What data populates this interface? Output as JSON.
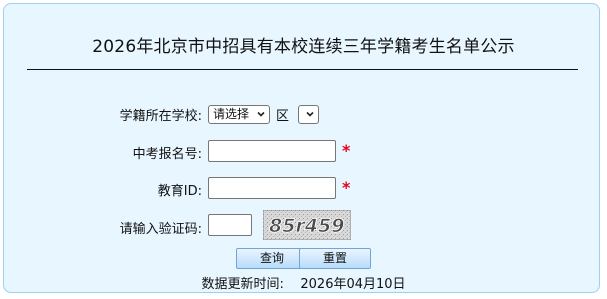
{
  "page": {
    "title": "2026年北京市中招具有本校连续三年学籍考生名单公示"
  },
  "form": {
    "school_label": "学籍所在学校:",
    "school_select_value": "请选择",
    "district_label": "区",
    "district_select_value": "",
    "exam_id_label": "中考报名号:",
    "exam_id_value": "",
    "edu_id_label": "教育ID:",
    "edu_id_value": "",
    "required_mark": "*",
    "captcha_label": "请输入验证码:",
    "captcha_value": "",
    "captcha_text": "85r459"
  },
  "buttons": {
    "query": "查询",
    "reset": "重置"
  },
  "footer": {
    "update_label": "数据更新时间:",
    "update_date": "2026年04月10日"
  },
  "colors": {
    "panel_bg": "#e8f6ff",
    "panel_border": "#9dd0ee",
    "required": "#e8001c",
    "button_border": "#6fa6d6"
  }
}
